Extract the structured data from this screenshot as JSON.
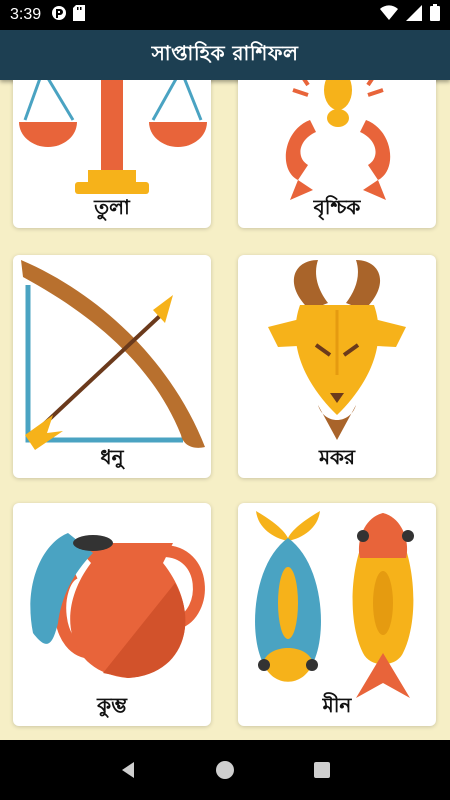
{
  "status_bar": {
    "time": "3:39",
    "icons": [
      "notification-icon",
      "sd-card-icon",
      "wifi-icon",
      "signal-icon",
      "battery-icon"
    ]
  },
  "app_bar": {
    "title": "সাপ্তাহিক রাশিফল",
    "color": "#1d3f52"
  },
  "background_color": "#f6efc6",
  "signs": [
    {
      "label": "তুলা",
      "icon": "libra-scales-icon"
    },
    {
      "label": "বৃশ্চিক",
      "icon": "scorpio-scorpion-icon"
    },
    {
      "label": "ধনু",
      "icon": "sagittarius-bow-arrow-icon"
    },
    {
      "label": "মকর",
      "icon": "capricorn-goat-icon"
    },
    {
      "label": "কুম্ভ",
      "icon": "aquarius-water-pot-icon"
    },
    {
      "label": "মীন",
      "icon": "pisces-fish-icon"
    }
  ],
  "nav_bar": {
    "buttons": [
      "back-icon",
      "home-icon",
      "recents-icon"
    ]
  }
}
